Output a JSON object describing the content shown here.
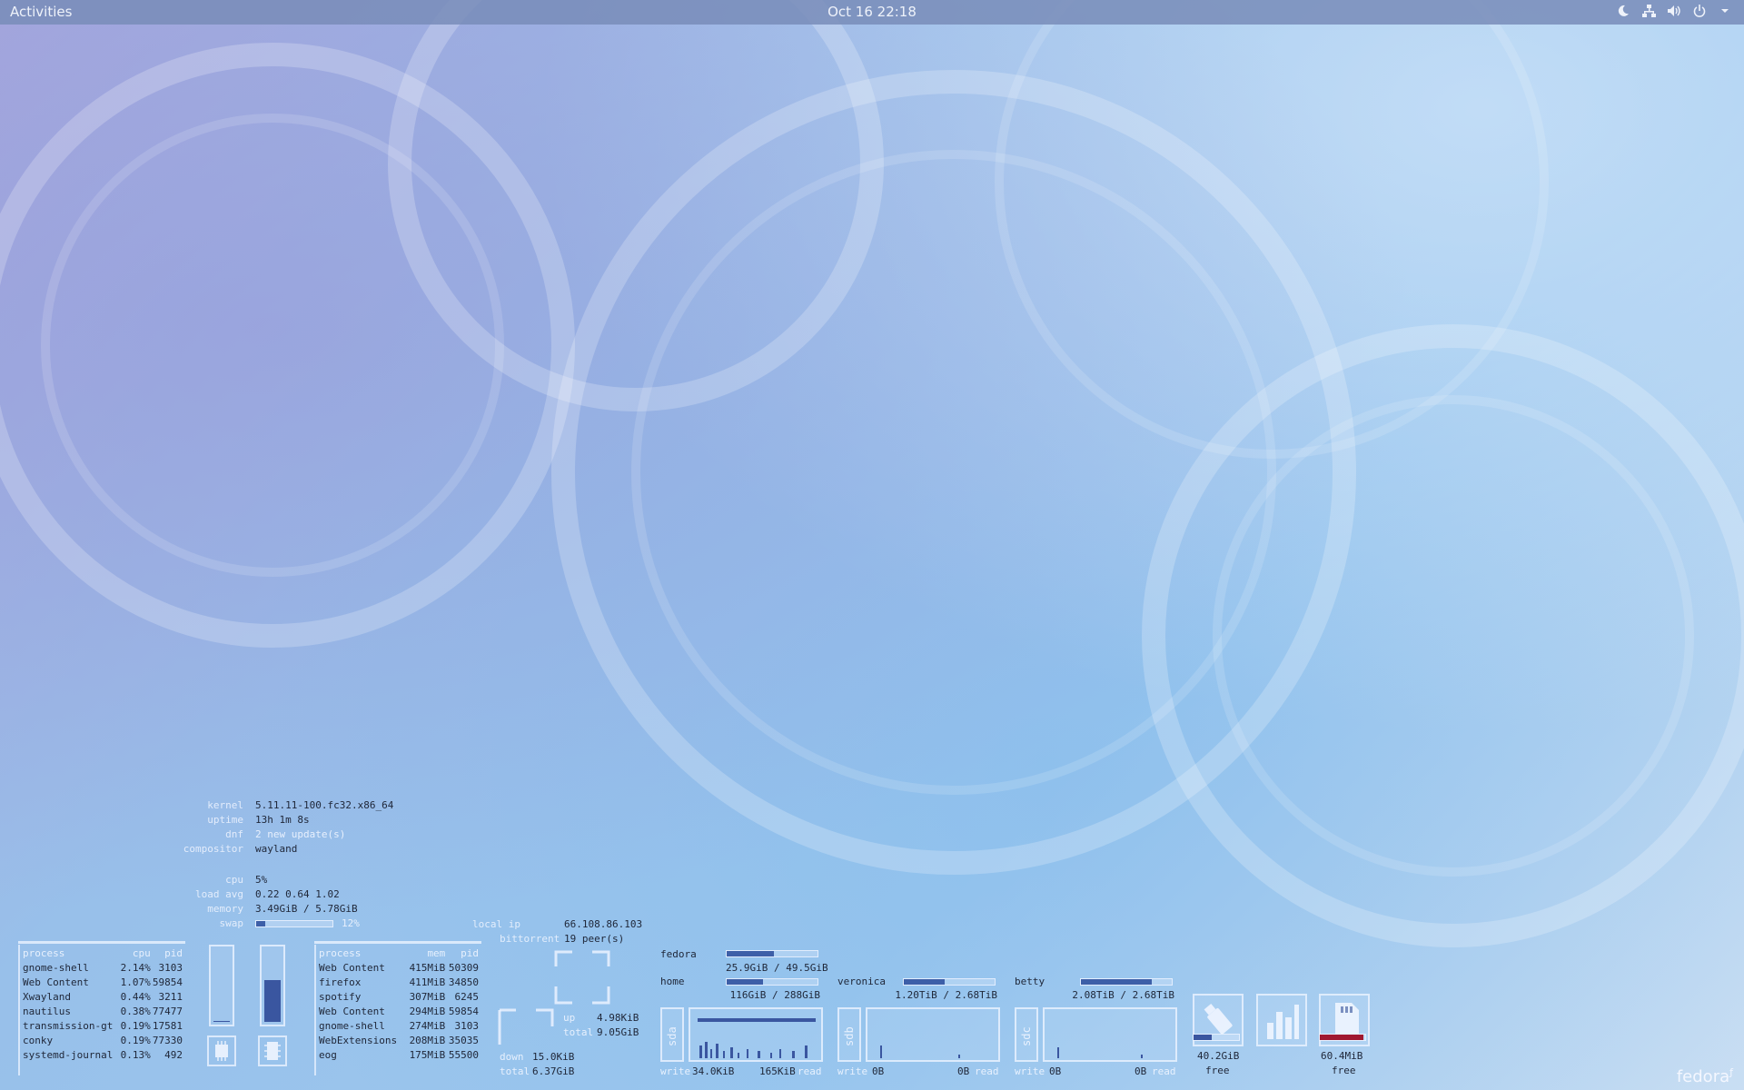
{
  "topbar": {
    "activities_label": "Activities",
    "clock": "Oct 16  22:18",
    "tray_icons": [
      "night-light-icon",
      "network-icon",
      "volume-icon",
      "power-icon",
      "chevron-down-icon"
    ]
  },
  "system": {
    "kernel_label": "kernel",
    "kernel": "5.11.11-100.fc32.x86_64",
    "uptime_label": "uptime",
    "uptime": "13h 1m 8s",
    "dnf_label": "dnf",
    "dnf": "2 new update(s)",
    "compositor_label": "compositor",
    "compositor": "wayland",
    "cpu_label": "cpu",
    "cpu": "5%",
    "loadavg_label": "load avg",
    "loadavg": "0.22 0.64 1.02",
    "memory_label": "memory",
    "memory": "3.49GiB / 5.78GiB",
    "swap_label": "swap",
    "swap": "12%",
    "swap_fraction": 0.12
  },
  "cpu_table": {
    "headers": [
      "process",
      "cpu",
      "pid"
    ],
    "rows": [
      [
        "gnome-shell",
        "2.14%",
        "3103"
      ],
      [
        "Web Content",
        "1.07%",
        "59854"
      ],
      [
        "Xwayland",
        "0.44%",
        "3211"
      ],
      [
        "nautilus",
        "0.38%",
        "77477"
      ],
      [
        "transmission-gt",
        "0.19%",
        "17581"
      ],
      [
        "conky",
        "0.19%",
        "77330"
      ],
      [
        "systemd-journal",
        "0.13%",
        "492"
      ]
    ]
  },
  "gauges": {
    "cpu_fraction": 0.08,
    "memory_fraction": 0.6
  },
  "mem_table": {
    "headers": [
      "process",
      "mem",
      "pid"
    ],
    "rows": [
      [
        "Web Content",
        "415MiB",
        "50309"
      ],
      [
        "firefox",
        "411MiB",
        "34850"
      ],
      [
        "spotify",
        "307MiB",
        "6245"
      ],
      [
        "Web Content",
        "294MiB",
        "59854"
      ],
      [
        "gnome-shell",
        "274MiB",
        "3103"
      ],
      [
        "WebExtensions",
        "208MiB",
        "35035"
      ],
      [
        "eog",
        "175MiB",
        "55500"
      ]
    ]
  },
  "network": {
    "local_ip_label": "local ip",
    "local_ip": "66.108.86.103",
    "bittorrent_label": "bittorrent",
    "bittorrent": "19 peer(s)",
    "up_label": "up",
    "up": "4.98KiB",
    "up_total_label": "total",
    "up_total": "9.05GiB",
    "down_label": "down",
    "down": "15.0KiB",
    "down_total_label": "total",
    "down_total": "6.37GiB"
  },
  "filesystems": [
    {
      "name": "fedora",
      "usage": "25.9GiB / 49.5GiB",
      "fraction": 0.52
    },
    {
      "name": "home",
      "usage": "116GiB / 288GiB",
      "fraction": 0.4
    },
    {
      "name": "veronica",
      "usage": "1.20TiB / 2.68TiB",
      "fraction": 0.45
    },
    {
      "name": "betty",
      "usage": "2.08TiB / 2.68TiB",
      "fraction": 0.78
    }
  ],
  "disks": [
    {
      "name": "sda",
      "write_label": "write",
      "write": "34.0KiB",
      "read": "165KiB",
      "read_label": "read"
    },
    {
      "name": "sdb",
      "write_label": "write",
      "write": "0B",
      "read": "0B",
      "read_label": "read"
    },
    {
      "name": "sdc",
      "write_label": "write",
      "write": "0B",
      "read": "0B",
      "read_label": "read"
    }
  ],
  "devices": [
    {
      "icon": "usb-drive-icon",
      "value": "40.2GiB",
      "label": "free",
      "fraction": 0.4,
      "color": "#3a56a0"
    },
    {
      "icon": "bar-chart-icon",
      "value": "",
      "label": ""
    },
    {
      "icon": "sd-card-icon",
      "value": "60.4MiB",
      "label": "free",
      "fraction": 0.95,
      "color": "#a01830"
    }
  ],
  "branding": {
    "logo_text": "fedora"
  }
}
